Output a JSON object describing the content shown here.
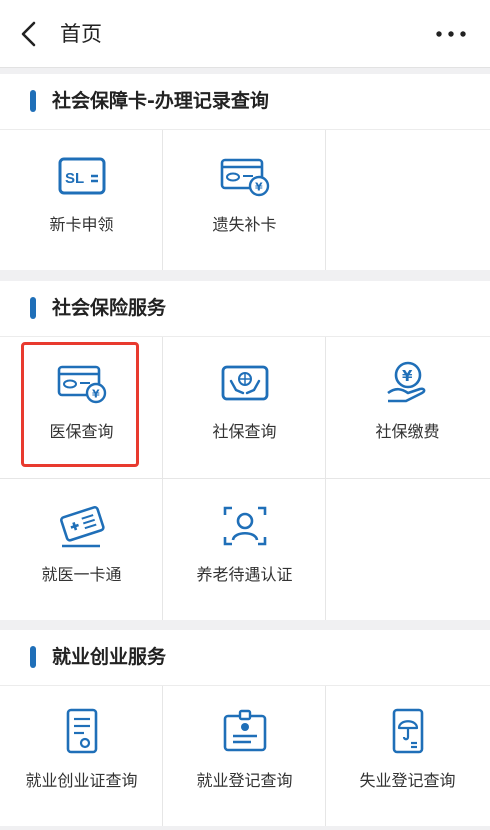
{
  "header": {
    "title": "首页"
  },
  "sections": [
    {
      "title": "社会保障卡-办理记录查询",
      "items": [
        {
          "label": "新卡申领",
          "icon": "sl-card-icon"
        },
        {
          "label": "遗失补卡",
          "icon": "card-yen-icon"
        }
      ]
    },
    {
      "title": "社会保险服务",
      "items": [
        {
          "label": "医保查询",
          "icon": "card-yen-icon"
        },
        {
          "label": "社保查询",
          "icon": "hands-globe-icon"
        },
        {
          "label": "社保缴费",
          "icon": "yen-coin-hand-icon"
        },
        {
          "label": "就医一卡通",
          "icon": "medical-card-icon"
        },
        {
          "label": "养老待遇认证",
          "icon": "face-scan-icon"
        }
      ]
    },
    {
      "title": "就业创业服务",
      "items": [
        {
          "label": "就业创业证查询",
          "icon": "certificate-icon"
        },
        {
          "label": "就业登记查询",
          "icon": "id-badge-icon"
        },
        {
          "label": "失业登记查询",
          "icon": "umbrella-doc-icon"
        }
      ]
    }
  ],
  "colors": {
    "accent": "#1f6fb8",
    "highlight": "#e83a2f"
  }
}
